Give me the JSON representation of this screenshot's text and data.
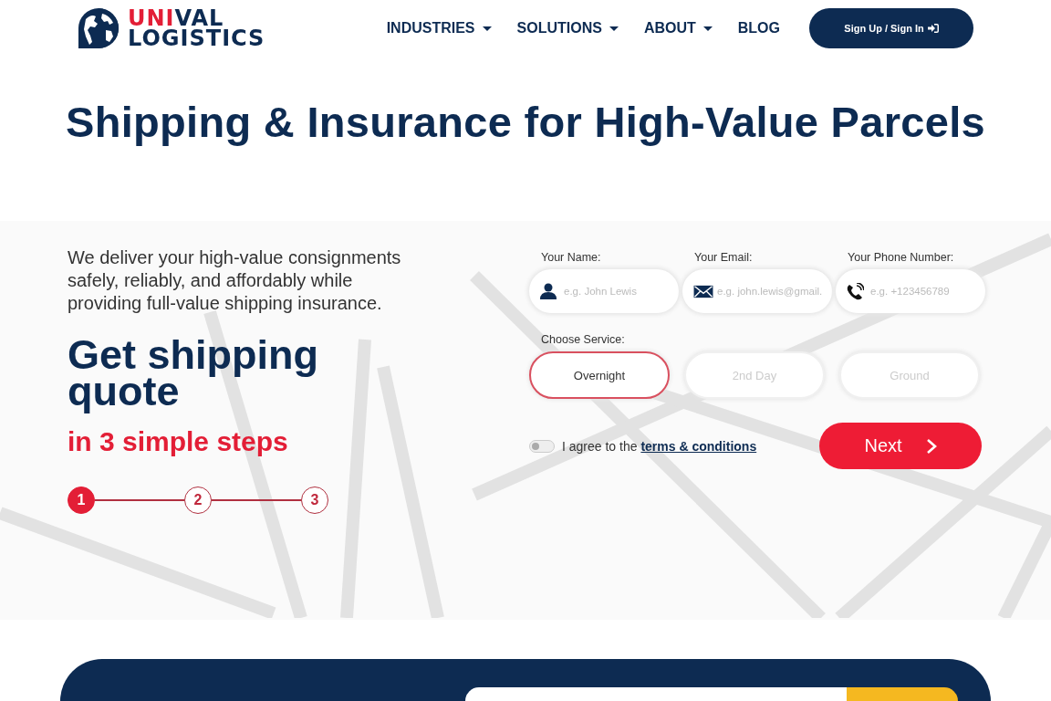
{
  "header": {
    "logo": {
      "line_1_red": "UNI",
      "line_1_blue": "VAL",
      "line_2": "LOGISTICS"
    },
    "nav": [
      {
        "label": "INDUSTRIES",
        "dropdown": true
      },
      {
        "label": "SOLUTIONS",
        "dropdown": true
      },
      {
        "label": "ABOUT",
        "dropdown": true
      },
      {
        "label": "BLOG",
        "dropdown": false
      }
    ],
    "sign_in_button": "Sign Up / Sign In"
  },
  "title": "Shipping & Insurance for High-Value Parcels",
  "intro": {
    "description": "We deliver your high-value consignments safely, reliably, and affordably while providing full-value shipping insurance.",
    "heading": "Get shipping quote",
    "subheading": "in 3 simple steps",
    "steps": [
      {
        "label": "1",
        "selected": true
      },
      {
        "label": "2",
        "selected": false
      },
      {
        "label": "3",
        "selected": false
      }
    ]
  },
  "form": {
    "fields": [
      {
        "label": "Your Name:",
        "placeholder": "e.g. John Lewis",
        "kind": "person"
      },
      {
        "label": "Your Email:",
        "placeholder": "e.g. john.lewis@gmail.",
        "kind": "mail"
      },
      {
        "label": "Your Phone Number:",
        "placeholder": "e.g. +123456789",
        "kind": "phone"
      }
    ],
    "service_label": "Choose Service:",
    "services": [
      {
        "label": "Overnight",
        "selected": true
      },
      {
        "label": "2nd Day",
        "selected": false
      },
      {
        "label": "Ground",
        "selected": false
      }
    ],
    "agree": {
      "checked": false,
      "text": "I agree to the ",
      "link": "terms & conditions"
    },
    "next_button": "Next"
  }
}
